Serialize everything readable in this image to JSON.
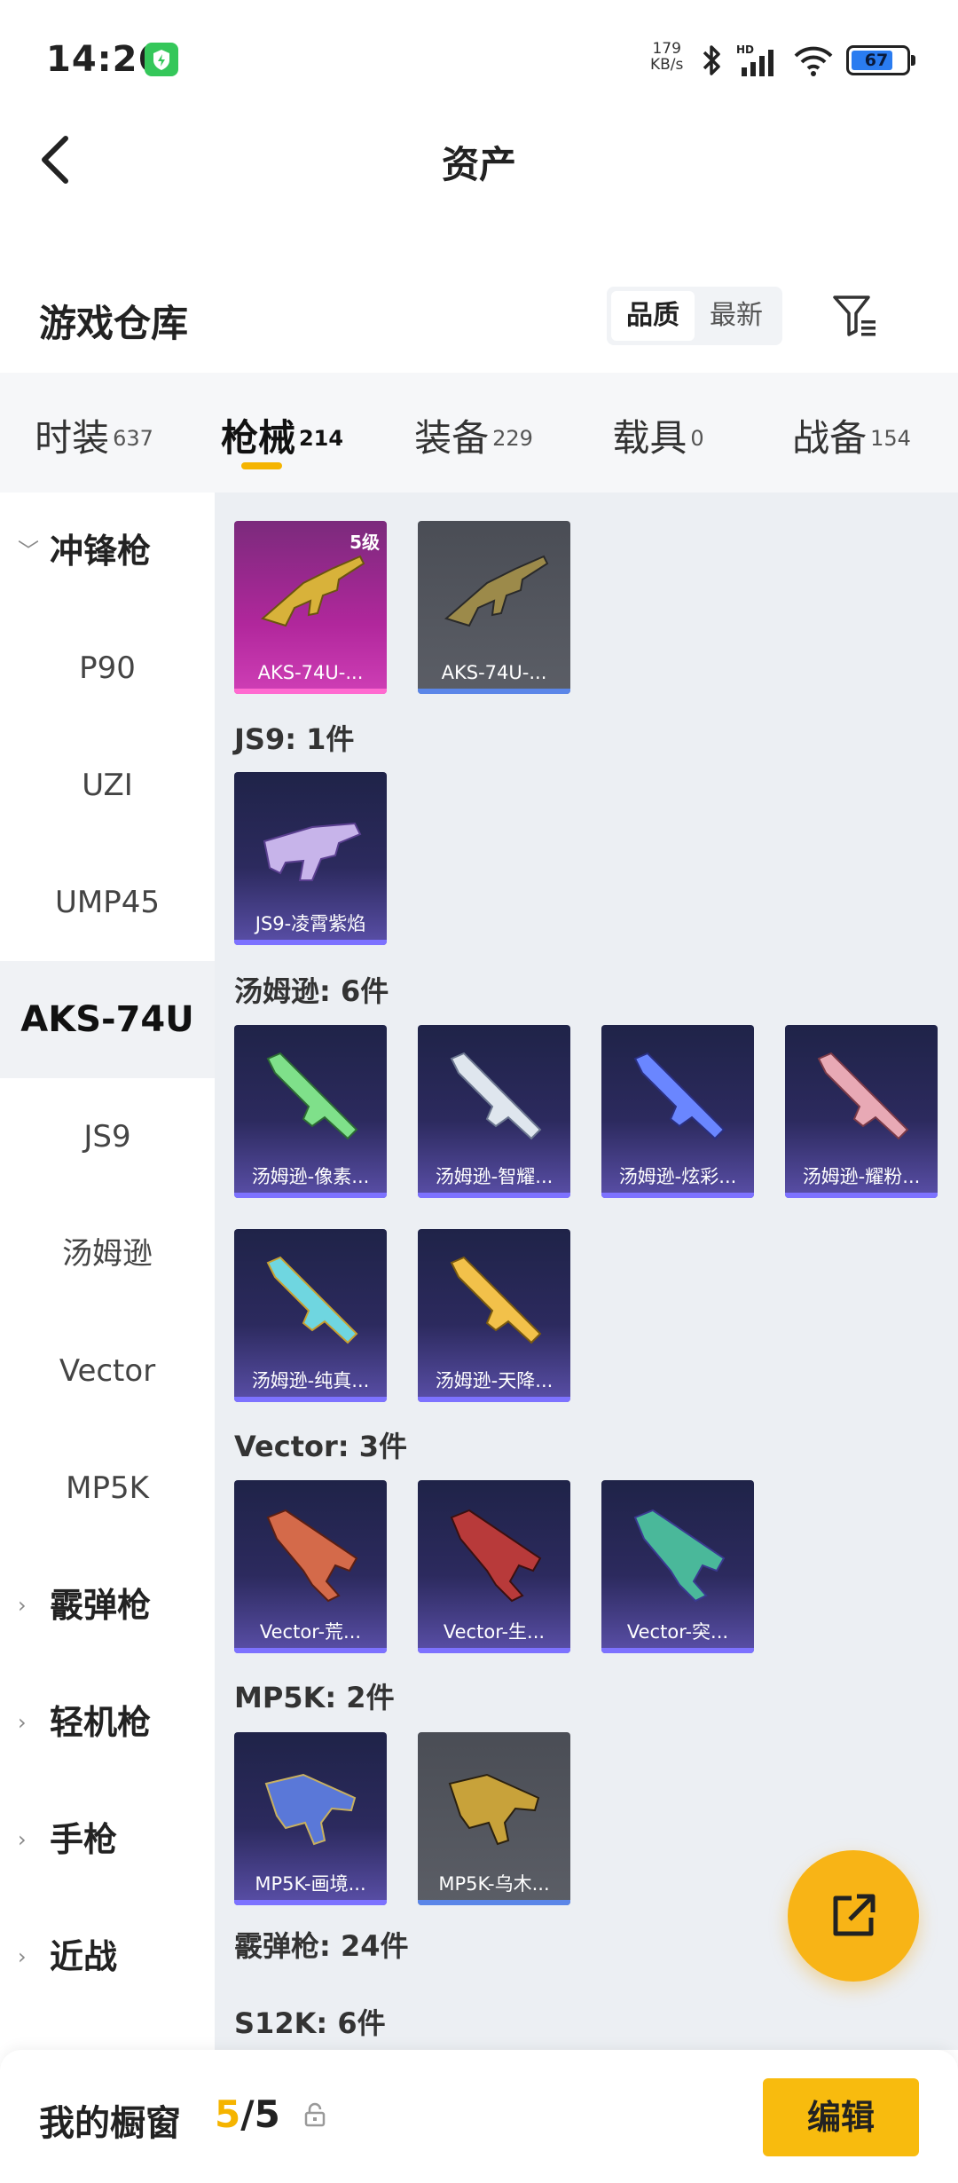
{
  "status_bar": {
    "time": "14:26",
    "net_speed_value": "179",
    "net_speed_unit": "KB/s",
    "battery_level": "67"
  },
  "nav": {
    "title": "资产"
  },
  "section": {
    "title": "游戏仓库",
    "sort_options": [
      "品质",
      "最新"
    ],
    "active_sort": "品质"
  },
  "tabs": [
    {
      "label": "时装",
      "count": "637"
    },
    {
      "label": "枪械",
      "count": "214"
    },
    {
      "label": "装备",
      "count": "229"
    },
    {
      "label": "载具",
      "count": "0"
    },
    {
      "label": "战备",
      "count": "154"
    }
  ],
  "sidebar": {
    "group_open": "冲锋枪",
    "items": [
      "P90",
      "UZI",
      "UMP45",
      "AKS-74U",
      "JS9",
      "汤姆逊",
      "Vector",
      "MP5K"
    ],
    "selected": "AKS-74U",
    "groups_closed": [
      "霰弹枪",
      "轻机枪",
      "手枪",
      "近战"
    ]
  },
  "content": {
    "aks_cards": [
      "AKS-74U-...",
      "AKS-74U-..."
    ],
    "aks_level_tag": "5级",
    "js9_title": "JS9: 1件",
    "js9_cards": [
      "JS9-凌霄紫焰"
    ],
    "tommy_title": "汤姆逊: 6件",
    "tommy_cards": [
      "汤姆逊-像素...",
      "汤姆逊-智耀...",
      "汤姆逊-炫彩...",
      "汤姆逊-耀粉...",
      "汤姆逊-纯真...",
      "汤姆逊-天降..."
    ],
    "vector_title": "Vector: 3件",
    "vector_cards": [
      "Vector-荒...",
      "Vector-生...",
      "Vector-突..."
    ],
    "mp5k_title": "MP5K: 2件",
    "mp5k_cards": [
      "MP5K-画境...",
      "MP5K-乌木..."
    ],
    "shotgun_title": "霰弹枪: 24件",
    "s12k_title": "S12K: 6件"
  },
  "bottom": {
    "title": "我的橱窗",
    "count_current": "5",
    "count_sep": "/",
    "count_total": "5",
    "edit_label": "编辑"
  },
  "colors": {
    "accent": "#f5b400",
    "card_purple": "#2c2a5e",
    "card_pink": "#b1279c",
    "card_grey": "#5b5e66"
  }
}
